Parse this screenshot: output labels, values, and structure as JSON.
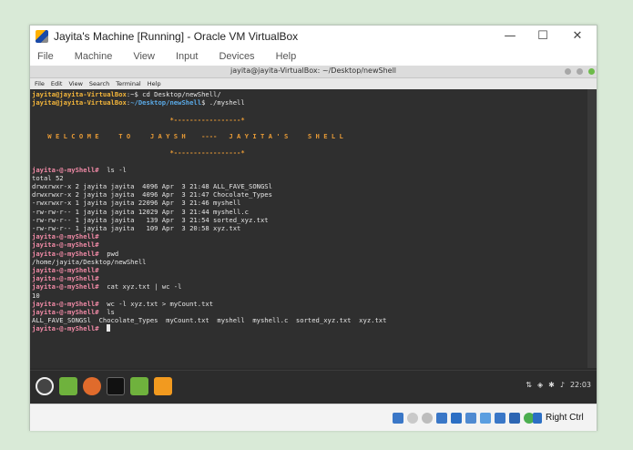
{
  "vbox": {
    "title": "Jayita's Machine [Running] - Oracle VM VirtualBox",
    "menu": [
      "File",
      "Machine",
      "View",
      "Input",
      "Devices",
      "Help"
    ],
    "host_key": "Right Ctrl"
  },
  "terminal": {
    "title": "jayita@jayita-VirtualBox: ~/Desktop/newShell",
    "menu": [
      "File",
      "Edit",
      "View",
      "Search",
      "Terminal",
      "Help"
    ],
    "lines": [
      [
        {
          "t": "jayita@jayita-VirtualBox",
          "c": "user"
        },
        {
          "t": ":~$ cd Desktop/newShell/"
        }
      ],
      [
        {
          "t": "jayita@jayita-VirtualBox",
          "c": "user"
        },
        {
          "t": ":"
        },
        {
          "t": "~/Desktop/newShell",
          "c": "path"
        },
        {
          "t": "$ ./myshell"
        }
      ],
      [],
      [
        {
          "t": "                                   *-----------------*",
          "c": "banner"
        }
      ],
      [],
      [
        {
          "t": "    W E L C O M E     T O     J A Y S H    ----   J A Y I T A ' S     S H E L L",
          "c": "banner"
        }
      ],
      [],
      [
        {
          "t": "                                   *-----------------*",
          "c": "banner"
        }
      ],
      [],
      [
        {
          "t": "jayita-@-myShell#",
          "c": "my"
        },
        {
          "t": "  ls -l"
        }
      ],
      [
        {
          "t": "total 52"
        }
      ],
      [
        {
          "t": "drwxrwxr-x 2 jayita jayita  4096 Apr  3 21:48 ALL_FAVE_SONGSl"
        }
      ],
      [
        {
          "t": "drwxrwxr-x 2 jayita jayita  4096 Apr  3 21:47 Chocolate_Types"
        }
      ],
      [
        {
          "t": "-rwxrwxr-x 1 jayita jayita 22096 Apr  3 21:46 myshell"
        }
      ],
      [
        {
          "t": "-rw-rw-r-- 1 jayita jayita 12029 Apr  3 21:44 myshell.c"
        }
      ],
      [
        {
          "t": "-rw-rw-r-- 1 jayita jayita   139 Apr  3 21:54 sorted_xyz.txt"
        }
      ],
      [
        {
          "t": "-rw-rw-r-- 1 jayita jayita   109 Apr  3 20:58 xyz.txt"
        }
      ],
      [
        {
          "t": "jayita-@-myShell#",
          "c": "my"
        }
      ],
      [
        {
          "t": "jayita-@-myShell#",
          "c": "my"
        }
      ],
      [
        {
          "t": "jayita-@-myShell#",
          "c": "my"
        },
        {
          "t": "  pwd"
        }
      ],
      [
        {
          "t": "/home/jayita/Desktop/newShell"
        }
      ],
      [
        {
          "t": "jayita-@-myShell#",
          "c": "my"
        }
      ],
      [
        {
          "t": "jayita-@-myShell#",
          "c": "my"
        }
      ],
      [
        {
          "t": "jayita-@-myShell#",
          "c": "my"
        },
        {
          "t": "  cat xyz.txt | wc -l"
        }
      ],
      [
        {
          "t": "10"
        }
      ],
      [
        {
          "t": "jayita-@-myShell#",
          "c": "my"
        },
        {
          "t": "  wc -l xyz.txt > myCount.txt"
        }
      ],
      [
        {
          "t": "jayita-@-myShell#",
          "c": "my"
        },
        {
          "t": "  ls"
        }
      ],
      [
        {
          "t": "ALL_FAVE_SONGSl  Chocolate_Types  myCount.txt  myshell  myshell.c  sorted_xyz.txt  xyz.txt"
        }
      ],
      [
        {
          "t": "jayita-@-myShell#",
          "c": "my"
        },
        {
          "t": "  "
        },
        {
          "t": "",
          "c": "cursor"
        }
      ]
    ]
  },
  "taskbar": {
    "clock": "22:03",
    "icons": [
      "mint-menu-icon",
      "folder-icon",
      "firefox-icon",
      "terminal-icon",
      "folder-icon",
      "sublime-text-icon"
    ]
  },
  "colors": {
    "prompt_user": "#f3b53a",
    "prompt_path": "#5aa9e6",
    "prompt_shell": "#f08aa6",
    "banner": "#e79a36",
    "terminal_bg": "#2f2f2f"
  }
}
